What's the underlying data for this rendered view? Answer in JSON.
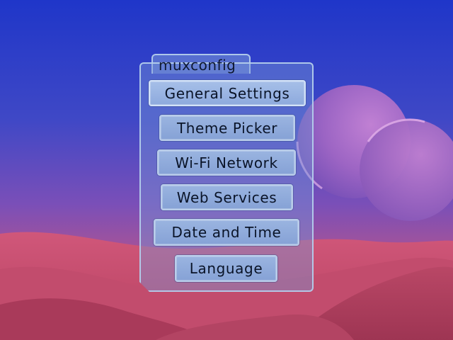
{
  "colors": {
    "sky_top": "#2238c8",
    "sky_mid": "#5a4cc0",
    "dune_pink": "#c8486e",
    "panel_border": "#b9cdea",
    "button_fill": "#8fa9da",
    "text_dark": "#0a1428"
  },
  "panel": {
    "title": "muxconfig"
  },
  "menu": {
    "items": [
      {
        "label": "General Settings"
      },
      {
        "label": "Theme Picker"
      },
      {
        "label": "Wi-Fi Network"
      },
      {
        "label": "Web Services"
      },
      {
        "label": "Date and Time"
      },
      {
        "label": "Language"
      }
    ],
    "selected_index": 0
  }
}
